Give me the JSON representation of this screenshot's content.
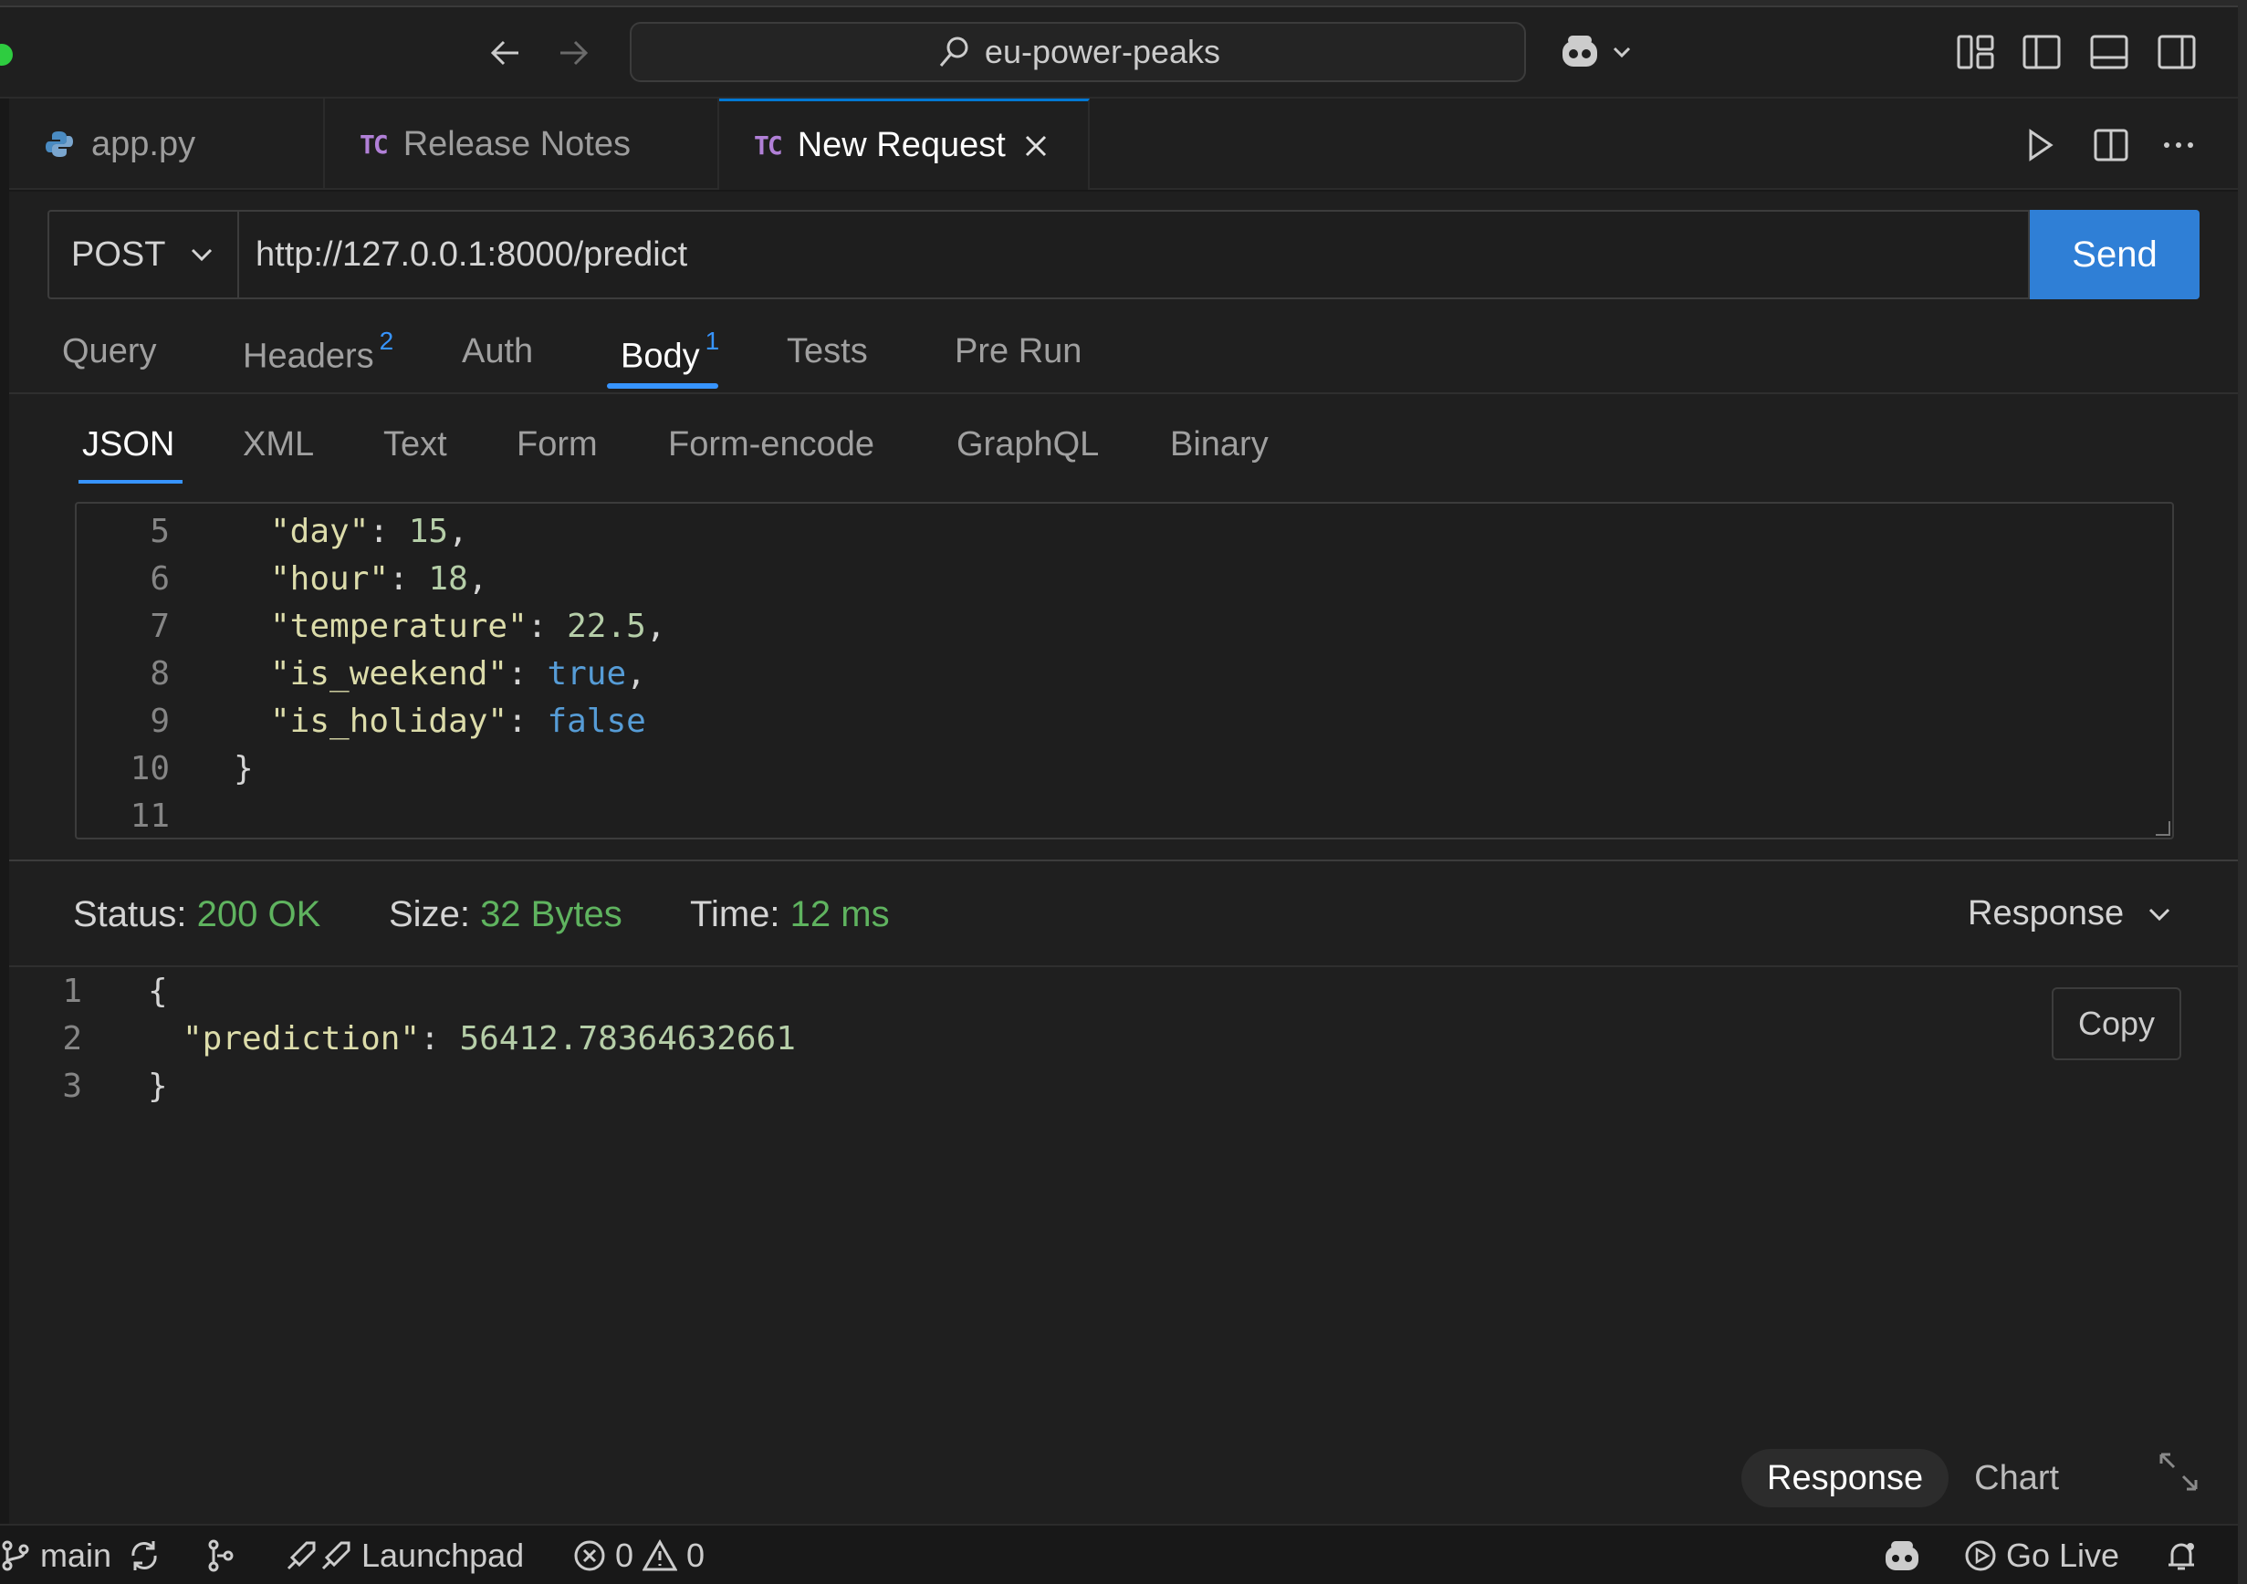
{
  "titlebar": {
    "search_text": "eu-power-peaks"
  },
  "tabs": [
    {
      "label": "app.py",
      "icon": "python-icon"
    },
    {
      "label": "Release Notes",
      "badge": "TC"
    },
    {
      "label": "New Request",
      "badge": "TC",
      "active": true
    }
  ],
  "request": {
    "method": "POST",
    "url": "http://127.0.0.1:8000/predict",
    "send_label": "Send"
  },
  "request_tabs": {
    "query": "Query",
    "headers": "Headers",
    "headers_count": "2",
    "auth": "Auth",
    "body": "Body",
    "body_count": "1",
    "tests": "Tests",
    "prerun": "Pre Run"
  },
  "body_tabs": {
    "json": "JSON",
    "xml": "XML",
    "text": "Text",
    "form": "Form",
    "form_encode": "Form-encode",
    "graphql": "GraphQL",
    "binary": "Binary"
  },
  "body_editor": {
    "lines": [
      {
        "n": "5",
        "key": "\"day\"",
        "value": "15",
        "type": "num",
        "comma": ","
      },
      {
        "n": "6",
        "key": "\"hour\"",
        "value": "18",
        "type": "num",
        "comma": ","
      },
      {
        "n": "7",
        "key": "\"temperature\"",
        "value": "22.5",
        "type": "num",
        "comma": ","
      },
      {
        "n": "8",
        "key": "\"is_weekend\"",
        "value": "true",
        "type": "bool",
        "comma": ","
      },
      {
        "n": "9",
        "key": "\"is_holiday\"",
        "value": "false",
        "type": "bool",
        "comma": ""
      },
      {
        "n": "10",
        "brace": "}"
      },
      {
        "n": "11"
      }
    ]
  },
  "response_meta": {
    "status_label": "Status:",
    "status_value": "200 OK",
    "size_label": "Size:",
    "size_value": "32 Bytes",
    "time_label": "Time:",
    "time_value": "12 ms",
    "view_select": "Response"
  },
  "response_body": {
    "line1_n": "1",
    "line1": "{",
    "line2_n": "2",
    "line2_key": "\"prediction\"",
    "line2_value": "56412.78364632661",
    "line3_n": "3",
    "line3": "}",
    "copy_label": "Copy"
  },
  "view_toggle": {
    "response": "Response",
    "chart": "Chart"
  },
  "statusbar": {
    "branch": "main",
    "launchpad": "Launchpad",
    "errors": "0",
    "warnings": "0",
    "go_live": "Go Live"
  },
  "colors": {
    "accent": "#3794ff",
    "send_button": "#2f7fd6",
    "success": "#5fb35f",
    "background": "#1f1f1f"
  }
}
